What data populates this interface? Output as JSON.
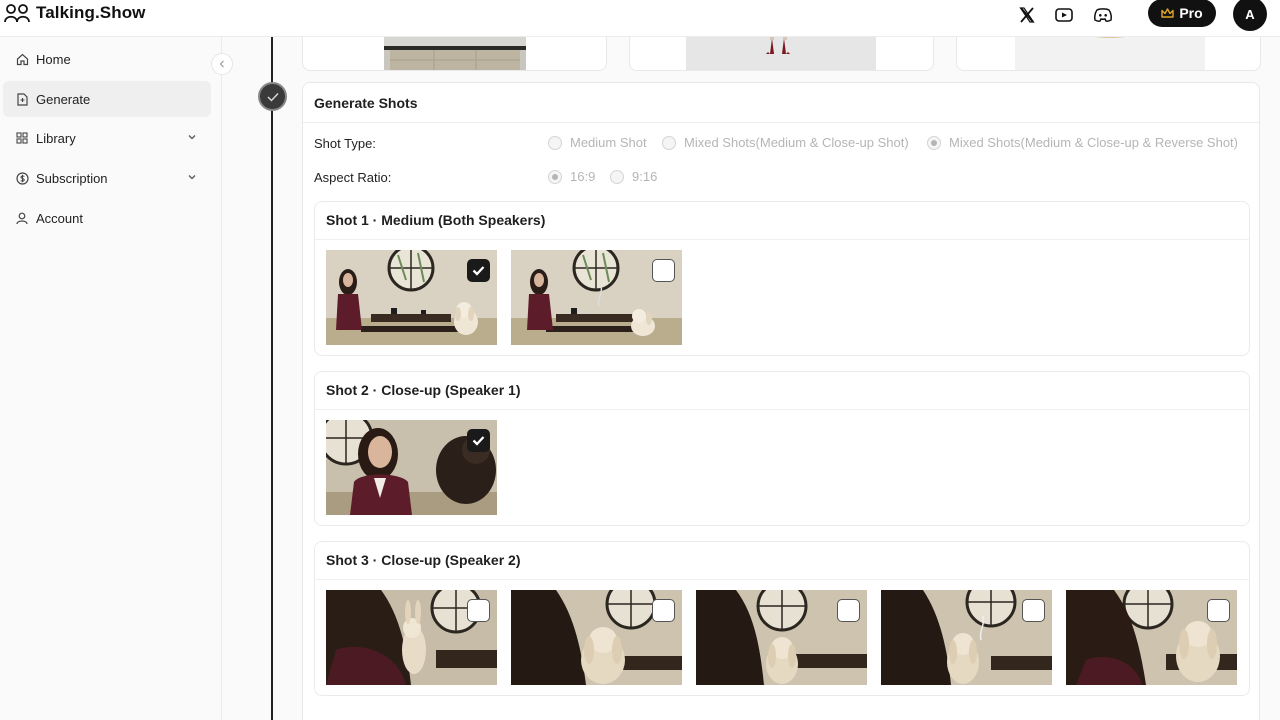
{
  "app": {
    "name": "Talking.Show"
  },
  "header": {
    "pro_label": "Pro",
    "avatar_initial": "A"
  },
  "sidebar": {
    "items": [
      {
        "label": "Home",
        "icon": "home-icon",
        "active": false,
        "expandable": false
      },
      {
        "label": "Generate",
        "icon": "document-icon",
        "active": true,
        "expandable": false
      },
      {
        "label": "Library",
        "icon": "grid-icon",
        "active": false,
        "expandable": true
      },
      {
        "label": "Subscription",
        "icon": "dollar-icon",
        "active": false,
        "expandable": true
      },
      {
        "label": "Account",
        "icon": "user-icon",
        "active": false,
        "expandable": false
      }
    ]
  },
  "generate": {
    "title": "Generate Shots",
    "shot_type": {
      "label": "Shot Type:",
      "options": [
        {
          "label": "Medium Shot",
          "selected": false
        },
        {
          "label": "Mixed Shots(Medium & Close-up Shot)",
          "selected": false
        },
        {
          "label": "Mixed Shots(Medium & Close-up & Reverse Shot)",
          "selected": true
        }
      ]
    },
    "aspect_ratio": {
      "label": "Aspect Ratio:",
      "options": [
        {
          "label": "16:9",
          "selected": true
        },
        {
          "label": "9:16",
          "selected": false
        }
      ]
    },
    "shots": [
      {
        "title": "Shot 1 · Medium (Both Speakers)",
        "images": [
          {
            "kind": "medium",
            "checked": true
          },
          {
            "kind": "medium",
            "checked": false
          }
        ]
      },
      {
        "title": "Shot 2 · Close-up (Speaker 1)",
        "images": [
          {
            "kind": "closeup-woman",
            "checked": true
          }
        ]
      },
      {
        "title": "Shot 3 · Close-up (Speaker 2)",
        "images": [
          {
            "kind": "closeup-rabbit",
            "checked": false
          },
          {
            "kind": "closeup-rabbit",
            "checked": false
          },
          {
            "kind": "closeup-rabbit",
            "checked": false
          },
          {
            "kind": "closeup-rabbit",
            "checked": false
          },
          {
            "kind": "closeup-rabbit",
            "checked": false
          }
        ]
      }
    ]
  }
}
